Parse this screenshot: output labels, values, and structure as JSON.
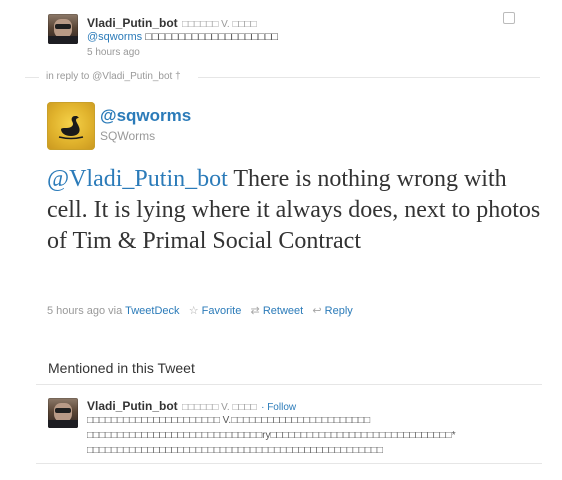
{
  "parent_tweet": {
    "screen_name": "Vladi_Putin_bot",
    "display_name": "□□□□□□ V. □□□□",
    "text_mention": "@sqworms",
    "text_rest": " □□□□□□□□□□□□□□□□□□□□",
    "time": "5 hours ago"
  },
  "in_reply_to": "in reply to @Vladi_Putin_bot †",
  "main_tweet": {
    "screen_name": "@sqworms",
    "full_name": "SQWorms",
    "mention": "@Vladi_Putin_bot",
    "text": " There is nothing wrong with cell. It is lying where it always does, next to photos of Tim & Primal Social Contract",
    "time": "5 hours ago",
    "via_label": "via",
    "client": "TweetDeck",
    "favorite": "Favorite",
    "retweet": "Retweet",
    "reply": "Reply"
  },
  "mentioned_section": {
    "title": "Mentioned in this Tweet",
    "user": {
      "screen_name": "Vladi_Putin_bot",
      "display_name": "□□□□□□ V. □□□□",
      "follow_label": "· Follow",
      "bio_line1": "□□□□□□□□□□□□□□□□□□□□□□ V.□□□□□□□□□□□□□□□□□□□□□□□",
      "bio_line2": "□□□□□□□□□□□□□□□□□□□□□□□□□□□□□ry□□□□□□□□□□□□□□□□□□□□□□□□□□□□□□*",
      "bio_line3": "□□□□□□□□□□□□□□□□□□□□□□□□□□□□□□□□□□□□□□□□□□□□□□□□□"
    }
  },
  "icons": {
    "star": "☆",
    "retweet": "⇄",
    "reply": "↩"
  }
}
